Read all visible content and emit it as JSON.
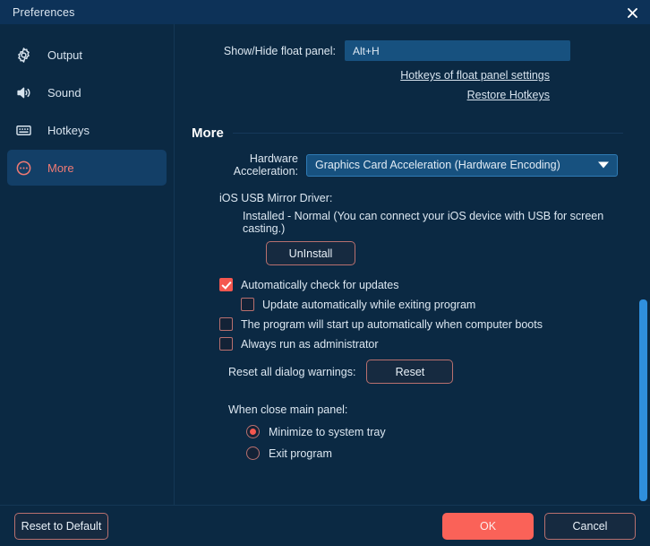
{
  "window": {
    "title": "Preferences",
    "close_icon": "close-icon"
  },
  "sidebar": {
    "items": [
      {
        "label": "Output",
        "icon": "gear-icon",
        "selected": false
      },
      {
        "label": "Sound",
        "icon": "speaker-icon",
        "selected": false
      },
      {
        "label": "Hotkeys",
        "icon": "keyboard-icon",
        "selected": false
      },
      {
        "label": "More",
        "icon": "more-circle-icon",
        "selected": true
      }
    ]
  },
  "hotkeys": {
    "float_panel_label": "Show/Hide float panel:",
    "float_panel_value": "Alt+H",
    "link_settings": "Hotkeys of float panel settings",
    "link_restore": "Restore Hotkeys"
  },
  "more": {
    "section_title": "More",
    "hardware_acceleration_label": "Hardware Acceleration:",
    "hardware_acceleration_value": "Graphics Card Acceleration (Hardware Encoding)",
    "driver_title": "iOS USB Mirror Driver:",
    "driver_status": "Installed - Normal (You can connect your iOS device with USB for screen casting.)",
    "uninstall_label": "UnInstall",
    "checkboxes": [
      {
        "label": "Automatically check for updates",
        "checked": true,
        "indent": 0
      },
      {
        "label": "Update automatically while exiting program",
        "checked": false,
        "indent": 1
      },
      {
        "label": "The program will start up automatically when computer boots",
        "checked": false,
        "indent": 0
      },
      {
        "label": "Always run as administrator",
        "checked": false,
        "indent": 0
      }
    ],
    "reset_warnings_label": "Reset all dialog warnings:",
    "reset_button_label": "Reset",
    "close_panel_label": "When close main panel:",
    "radios": [
      {
        "label": "Minimize to system tray",
        "selected": true
      },
      {
        "label": "Exit program",
        "selected": false
      }
    ]
  },
  "footer": {
    "reset_to_default": "Reset to Default",
    "ok": "OK",
    "cancel": "Cancel"
  },
  "colors": {
    "accent": "#fa6258",
    "window_bg": "#0b2943",
    "titlebar_bg": "#0d3258",
    "field_bg": "#17517f",
    "scrollbar": "#2f8fdd"
  }
}
